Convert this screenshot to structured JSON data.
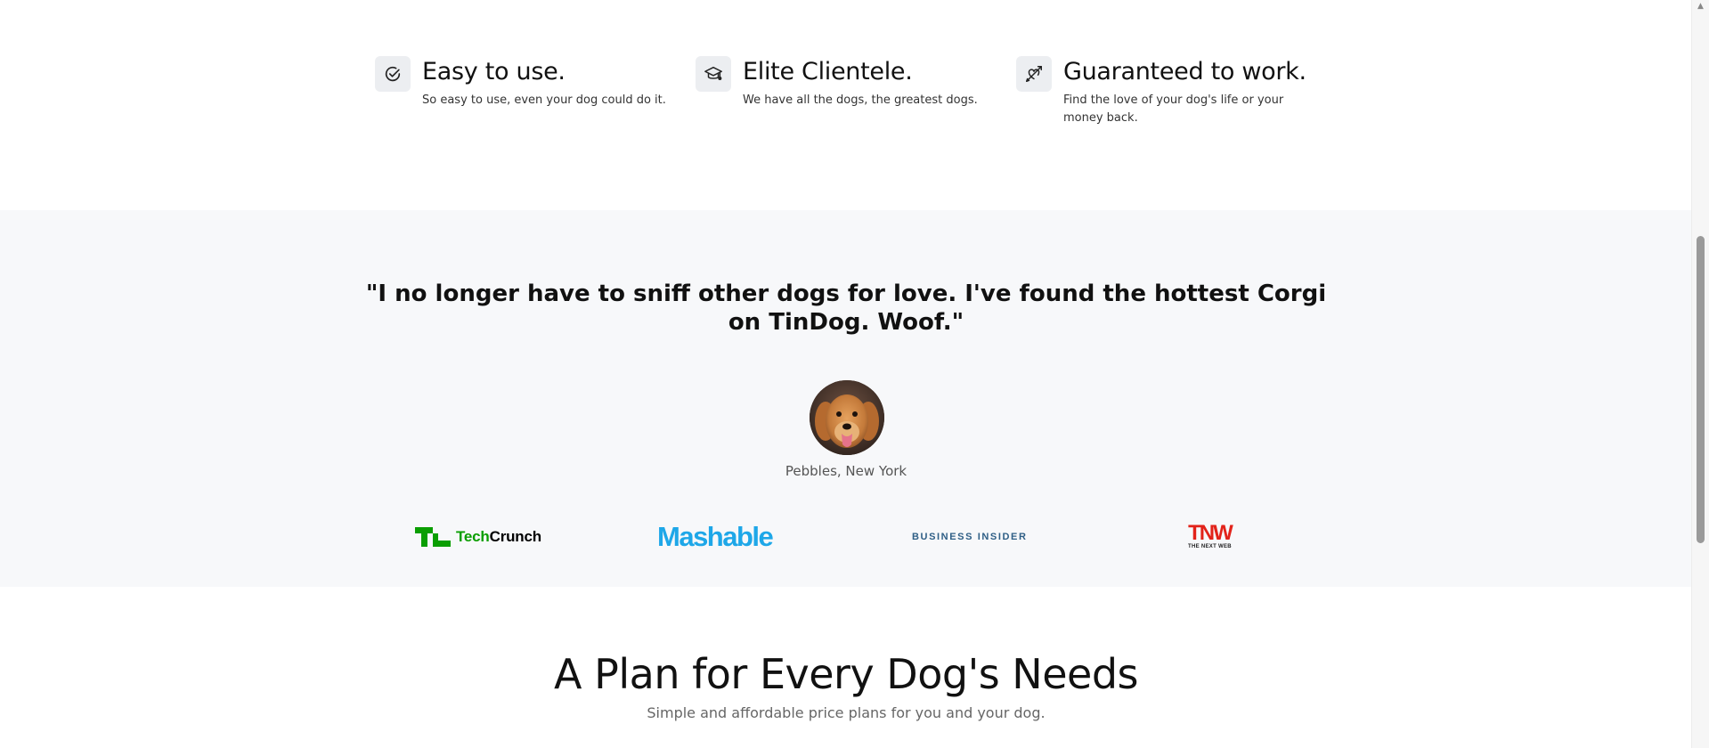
{
  "features": [
    {
      "title": "Easy to use.",
      "description": "So easy to use, even your dog could do it.",
      "icon": "check-circle-icon"
    },
    {
      "title": "Elite Clientele.",
      "description": "We have all the dogs, the greatest dogs.",
      "icon": "graduation-cap-icon"
    },
    {
      "title": "Guaranteed to work.",
      "description": "Find the love of your dog's life or your money back.",
      "icon": "heart-arrow-icon"
    }
  ],
  "testimonial": {
    "quote": "\"I no longer have to sniff other dogs for love. I've found the hottest Corgi on TinDog. Woof.\"",
    "author": "Pebbles, New York"
  },
  "press_logos": {
    "techcrunch_tech": "Tech",
    "techcrunch_crunch": "Crunch",
    "mashable": "Mashable",
    "business_insider": "BUSINESS INSIDER",
    "tnw_main": "TNW",
    "tnw_sub": "THE NEXT WEB"
  },
  "pricing": {
    "title": "A Plan for Every Dog's Needs",
    "subtitle": "Simple and affordable price plans for you and your dog."
  },
  "colors": {
    "section_bg": "#f7f8fa",
    "techcrunch_green": "#0a9e01",
    "mashable_blue": "#1ea7e8",
    "tnw_red": "#e2231a"
  }
}
